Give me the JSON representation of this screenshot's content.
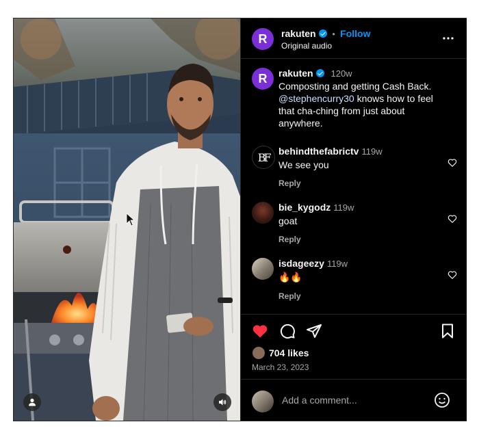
{
  "post": {
    "username": "rakuten",
    "dot": "•",
    "follow_label": "Follow",
    "audio": "Original audio",
    "avatar_letter": "R"
  },
  "caption": {
    "username": "rakuten",
    "time": "120w",
    "line1": "Composting and getting Cash Back.",
    "mention": "@stephencurry30",
    "rest": " knows how to feel that cha-ching from just about anywhere."
  },
  "comments": [
    {
      "username": "behindthefabrictv",
      "time": "119w",
      "text": "We see you",
      "reply": "Reply",
      "avatar": "BF"
    },
    {
      "username": "bie_kygodz",
      "time": "119w",
      "text": "goat",
      "reply": "Reply"
    },
    {
      "username": "isdageezy",
      "time": "119w",
      "text": "🔥🔥",
      "reply": "Reply"
    }
  ],
  "likes": {
    "count_text": "704 likes"
  },
  "date": "March 23, 2023",
  "add_comment": {
    "placeholder": "Add a comment..."
  },
  "icons": {
    "like": "heart-filled-icon",
    "comment": "comment-icon",
    "share": "paper-plane-icon",
    "save": "bookmark-icon",
    "more": "more-horizontal-icon",
    "emoji": "emoji-icon",
    "user_tag": "user-icon",
    "audio": "speaker-icon"
  },
  "colors": {
    "like_red": "#ff3040",
    "link_blue": "#0095f6",
    "brand_purple": "#7b2fd6"
  }
}
